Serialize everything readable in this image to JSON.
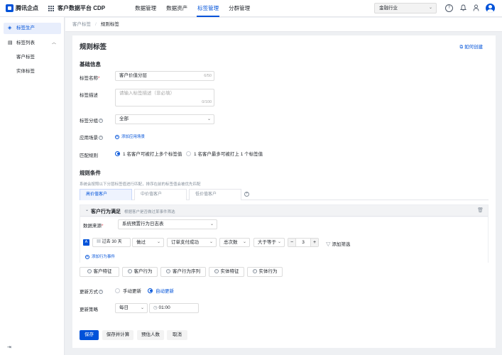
{
  "brand": {
    "logo": "腾讯企点",
    "platform": "客户数据平台 CDP"
  },
  "nav": [
    "数据管理",
    "数据资产",
    "标签管理",
    "分群管理"
  ],
  "nav_active": "标签管理",
  "industry_select": "金融行业",
  "topbar_icons": [
    "help-icon",
    "bell-icon",
    "user-icon",
    "avatar"
  ],
  "sidebar": {
    "items": [
      {
        "label": "标签生产",
        "icon": "compass-icon",
        "active": true
      },
      {
        "label": "标签列表",
        "icon": "list-icon",
        "expanded": true
      }
    ],
    "subitems": [
      "客户标签",
      "实体标签"
    ]
  },
  "breadcrumb": [
    "客户标签",
    "规则标签"
  ],
  "page_title": "规则标签",
  "howto_link": "如何创建",
  "basic": {
    "title": "基础信息",
    "name_label": "标签名称",
    "name_value": "客户价值分层",
    "name_count": "6/50",
    "desc_label": "标签描述",
    "desc_placeholder": "请输入标签描述（非必填）",
    "desc_count": "0/100",
    "group_label": "标签分组",
    "group_value": "全部",
    "scene_label": "应用场景",
    "scene_link": "添加应用场景",
    "match_label": "匹配规则",
    "match_options": [
      "1 名客户可被打上多个标签值",
      "1 名客户最多可被打上 1 个标签值"
    ],
    "match_selected": 0
  },
  "rules": {
    "title": "规则条件",
    "desc": "系统会按照以下分层标签值进行匹配，排序在前的标签值会被优先匹配",
    "tabs": [
      "高价值客户",
      "中价值客户",
      "低价值客户"
    ],
    "active_tab": 0,
    "condition": {
      "title": "客户行为满足",
      "subtitle": "根据客户是否做过某事件筛选",
      "source_label": "数据来源",
      "source_value": "系统预置行为日志表",
      "tag": "A",
      "date": "过去 30 天",
      "did": "做过",
      "event": "订单支付成功",
      "metric": "总次数",
      "operator": "大于等于",
      "minus": "−",
      "count": "3",
      "plus": "+",
      "filter": "添加筛选",
      "add_event": "添加行为事件"
    },
    "add_buttons": [
      "客户特征",
      "客户行为",
      "客户行为序列",
      "实体特征",
      "实体行为"
    ]
  },
  "update": {
    "mode_label": "更新方式",
    "mode_options": [
      "手动更新",
      "自动更新"
    ],
    "mode_selected": 1,
    "strategy_label": "更新策略",
    "freq": "每日",
    "time": "01:00"
  },
  "actions": [
    "保存",
    "保存并计算",
    "预估人数",
    "取消"
  ],
  "colors": {
    "primary": "#0052d9",
    "required": "#e34d59"
  }
}
